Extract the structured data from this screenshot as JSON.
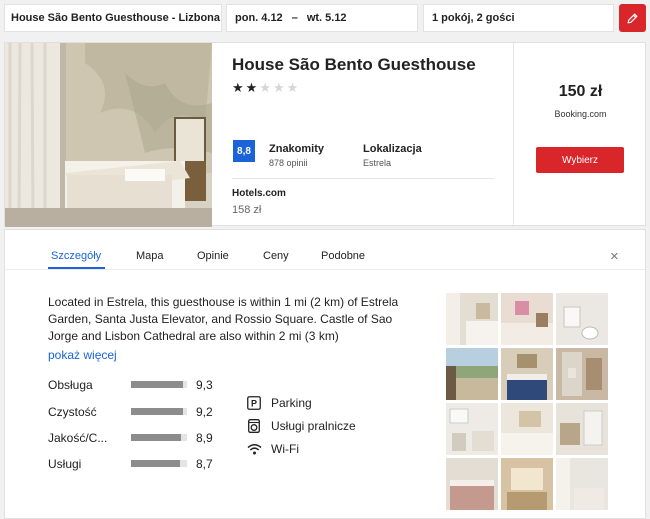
{
  "search": {
    "destination": "House São Bento Guesthouse - Lizbona",
    "check_in": "pon. 4.12",
    "dash": "–",
    "check_out": "wt. 5.12",
    "guests": "1 pokój, 2 gości"
  },
  "hotel": {
    "name": "House São Bento Guesthouse",
    "stars": 2,
    "max_stars": 5,
    "score": "8,8",
    "score_label": "Znakomity",
    "reviews": "878 opinii",
    "location_label": "Lokalizacja",
    "location_value": "Estrela",
    "alt_provider": "Hotels.com",
    "alt_price": "158 zł",
    "price": "150 zł",
    "provider": "Booking.com",
    "select_label": "Wybierz"
  },
  "details": {
    "tabs": [
      {
        "label": "Szczegóły",
        "active": true
      },
      {
        "label": "Mapa",
        "active": false
      },
      {
        "label": "Opinie",
        "active": false
      },
      {
        "label": "Ceny",
        "active": false
      },
      {
        "label": "Podobne",
        "active": false
      }
    ],
    "close_glyph": "×",
    "description": "Located in Estrela, this guesthouse is within 1 mi (2 km) of Estrela Garden, Santa Justa Elevator, and Rossio Square. Castle of Sao Jorge and Lisbon Cathedral are also within 2 mi (3 km)",
    "more_link": "pokaż więcej",
    "ratings": [
      {
        "label": "Obsługa",
        "value": "9,3",
        "score": 9.3
      },
      {
        "label": "Czystość",
        "value": "9,2",
        "score": 9.2
      },
      {
        "label": "Jakość/C...",
        "value": "8,9",
        "score": 8.9
      },
      {
        "label": "Usługi",
        "value": "8,7",
        "score": 8.7
      }
    ],
    "amenities": [
      {
        "icon": "parking-icon",
        "label": "Parking"
      },
      {
        "icon": "laundry-icon",
        "label": "Usługi pralnicze"
      },
      {
        "icon": "wifi-icon",
        "label": "Wi-Fi"
      }
    ]
  },
  "colors": {
    "accent_red": "#d9262b",
    "accent_blue": "#1a63d9"
  }
}
